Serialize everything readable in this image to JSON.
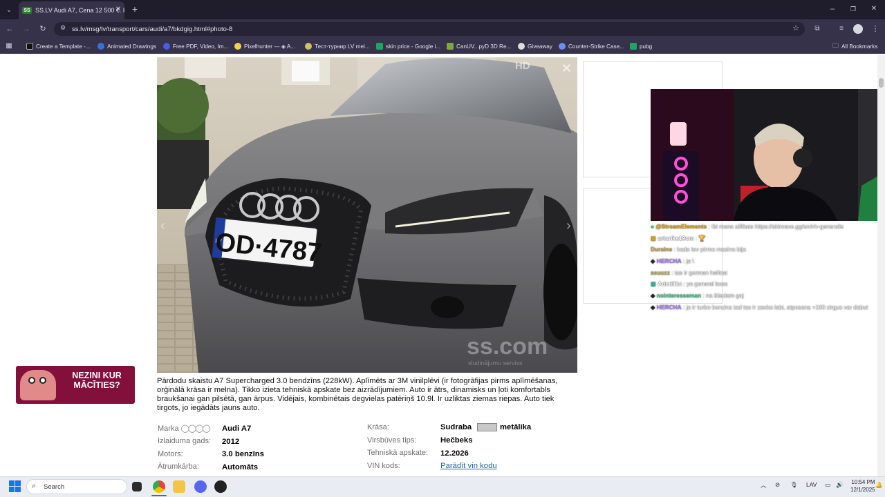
{
  "browser": {
    "tab_title": "SS.LV Audi A7, Cena 12 500 €. P",
    "favicon_text": "SS",
    "url": "ss.lv/msg/lv/transport/cars/audi/a7/bkdgig.html#photo-8",
    "bookmarks": [
      "Create a Template -...",
      "Animated Drawings",
      "Free PDF, Video, Im...",
      "Pixelhunter — ◈ A...",
      "Тест-турнир LV mei...",
      "skin price - Google i...",
      "CanUV...pyD 3D Re...",
      "Giveaway",
      "Counter-Strike Case...",
      "pubg"
    ],
    "all_bookmarks": "All Bookmarks"
  },
  "photo": {
    "plate": "OD·4787",
    "plate_country": "LV",
    "watermark": "ss.com",
    "watermark_sub": "sludinājumu serviss",
    "hd": "HD"
  },
  "listing": {
    "description": "Pārdodu skaistu A7 Supercharged 3.0 bendzīns (228kW). Aplīmēts ar 3M vinilplēvi (ir fotogrāfijas pirms aplīmēšanas, orģinālā krāsa ir melna). Tikko izieta tehniskā apskate bez aizrādījumiem. Auto ir ātrs, dinamisks un ļoti komfortabls braukšanai gan pilsētā, gan ārpus. Vidējais, kombinētais degvielas patēriņš 10.9l. Ir uzliktas ziemas riepas. Auto tiek tirgots, jo iegādāts jauns auto.",
    "specs_left": [
      {
        "label": "Marka",
        "value": "Audi A7"
      },
      {
        "label": "Izlaiduma gads:",
        "value": "2012"
      },
      {
        "label": "Motors:",
        "value": "3.0 benzīns"
      },
      {
        "label": "Ātrumkārba:",
        "value": "Automāts"
      }
    ],
    "specs_right": [
      {
        "label": "Krāsa:",
        "value": "Sudraba",
        "value_suffix": "metālika",
        "swatch": "#c8c8c8"
      },
      {
        "label": "Virsbūves tips:",
        "value": "Hečbeks"
      },
      {
        "label": "Tehniskā apskate:",
        "value": "12.2026"
      },
      {
        "label": "VIN kods:",
        "link": "Parādīt vin kodu"
      }
    ]
  },
  "ad": {
    "line1": "NEZINI KUR",
    "line2": "MĀCĪTIES?"
  },
  "chat": [
    {
      "user": "@StreamElements",
      "color": "#e0a300",
      "text": ": Ibi mans affiliate https://skinrave.gg/en/r/v-generalis"
    },
    {
      "user": "arturiks19cm",
      "color": "#ffffff",
      "text": ": 🏆"
    },
    {
      "user": "Duraine",
      "color": "#d2a54a",
      "text": ": kada tev pirma masina bija"
    },
    {
      "user": "HERCHA",
      "color": "#b07cff",
      "text": ": ja \\"
    },
    {
      "user": "ssuuzz",
      "color": "#c0b060",
      "text": ": tas ir german helfcat"
    },
    {
      "user": "Admiliks",
      "color": "#ffffff",
      "text": ": ya general boss"
    },
    {
      "user": "nointeresseman",
      "color": "#3ccf8e",
      "text": ": na šitadam gaj"
    },
    {
      "user": "HERCHA",
      "color": "#b07cff",
      "text": ": ja ir turbo benzins tad tas ir zaoka labi, atposana +100 zirgus var dabut"
    }
  ],
  "taskbar": {
    "search": "Search",
    "lang": "LAV",
    "time": "10:54 PM",
    "date": "12/1/2025"
  }
}
